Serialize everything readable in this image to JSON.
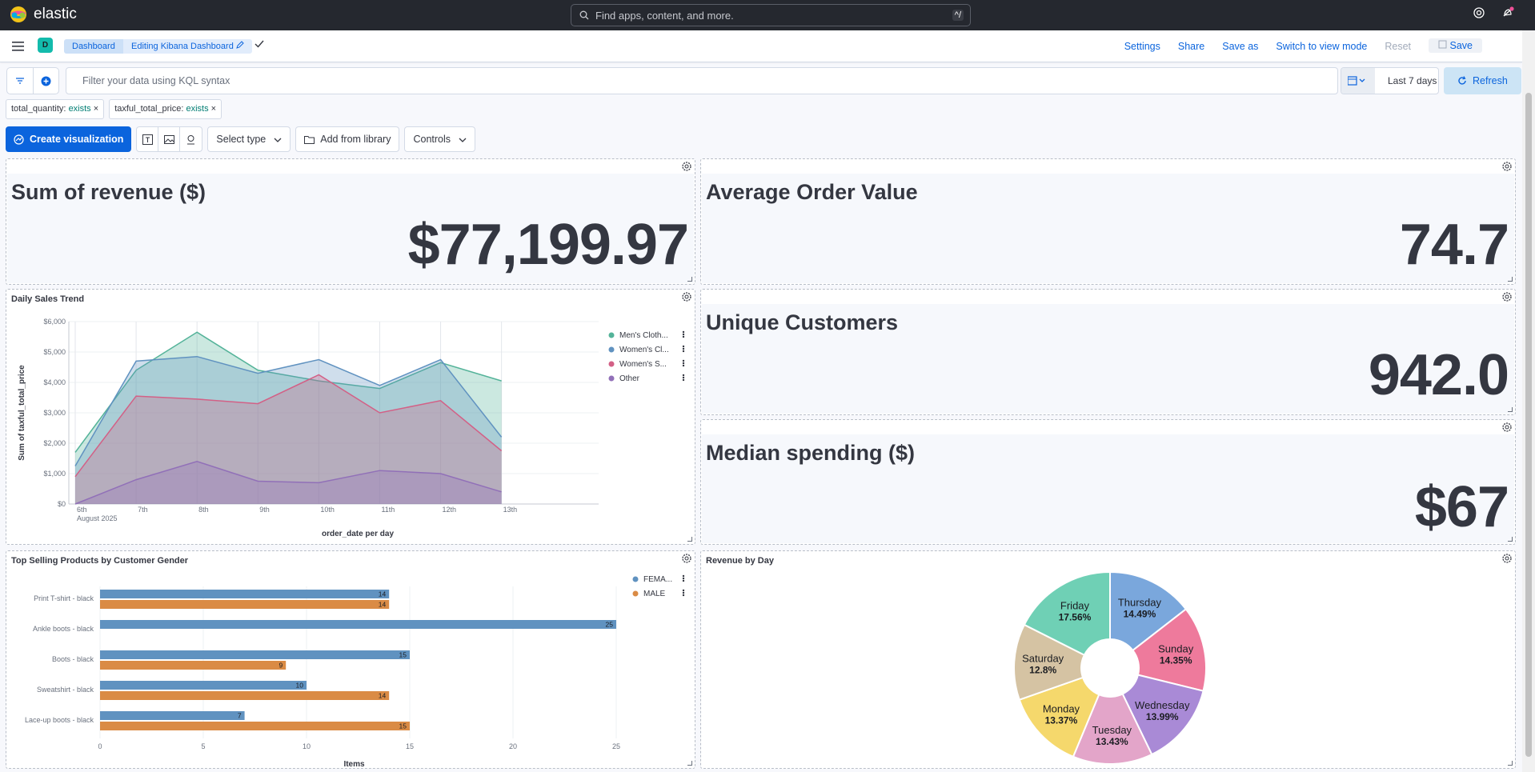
{
  "app": {
    "name": "elastic"
  },
  "search": {
    "placeholder": "Find apps, content, and more.",
    "shortcut": "^/"
  },
  "nav": {
    "avatar_letter": "D",
    "breadcrumbs": [
      "Dashboard",
      "Editing Kibana Dashboard"
    ],
    "menu": {
      "settings": "Settings",
      "share": "Share",
      "save_as": "Save as",
      "switch_view": "Switch to view mode",
      "reset": "Reset",
      "save": "Save"
    }
  },
  "query": {
    "placeholder": "Filter your data using KQL syntax",
    "time_range": "Last 7 days",
    "refresh": "Refresh"
  },
  "filters": [
    {
      "field": "total_quantity:",
      "op": "exists"
    },
    {
      "field": "taxful_total_price:",
      "op": "exists"
    }
  ],
  "toolbar": {
    "create": "Create visualization",
    "select_type": "Select type",
    "add_library": "Add from library",
    "controls": "Controls"
  },
  "metrics": {
    "revenue": {
      "title": "Sum of revenue ($)",
      "value": "$77,199.97"
    },
    "aov": {
      "title": "Average Order Value",
      "value": "74.7"
    },
    "customers": {
      "title": "Unique Customers",
      "value": "942.0"
    },
    "median": {
      "title": "Median spending ($)",
      "value": "$67"
    }
  },
  "panels": {
    "daily": "Daily Sales Trend",
    "products": "Top Selling Products by Customer Gender",
    "byday": "Revenue by Day"
  },
  "colors": {
    "accent": "#0b64dd",
    "green": "#54b399",
    "blue": "#6092c0",
    "pink": "#d36086",
    "purple": "#9170b8",
    "orange": "#da8b45"
  },
  "chart_data": [
    {
      "type": "area",
      "title": "Daily Sales Trend",
      "xlabel": "order_date per day",
      "ylabel": "Sum of taxful_total_price",
      "x": [
        "6th",
        "7th",
        "8th",
        "9th",
        "10th",
        "11th",
        "12th",
        "13th"
      ],
      "x_sublabel": "August 2025",
      "yticks": [
        "$0",
        "$1,000",
        "$2,000",
        "$3,000",
        "$4,000",
        "$5,000",
        "$6,000"
      ],
      "ylim": [
        0,
        6000
      ],
      "series": [
        {
          "name": "Men's Cloth...",
          "values": [
            1700,
            4400,
            5650,
            4400,
            4050,
            3800,
            4650,
            4050
          ]
        },
        {
          "name": "Women's Cl...",
          "values": [
            1250,
            4700,
            4850,
            4300,
            4750,
            3900,
            4750,
            2200
          ]
        },
        {
          "name": "Women's S...",
          "values": [
            900,
            3550,
            3450,
            3300,
            4250,
            3000,
            3400,
            1750
          ]
        },
        {
          "name": "Other",
          "values": [
            0,
            800,
            1400,
            750,
            700,
            1100,
            1000,
            400
          ]
        }
      ]
    },
    {
      "type": "bar",
      "title": "Top Selling Products by Customer Gender",
      "xlabel": "Items",
      "categories": [
        "Print T-shirt - black",
        "Ankle boots - black",
        "Boots - black",
        "Sweatshirt - black",
        "Lace-up boots - black"
      ],
      "xticks": [
        "0",
        "5",
        "10",
        "15",
        "20",
        "25"
      ],
      "xlim": [
        0,
        25
      ],
      "series": [
        {
          "name": "FEMA...",
          "values": [
            14,
            25,
            15,
            10,
            7
          ]
        },
        {
          "name": "MALE",
          "values": [
            14,
            null,
            9,
            14,
            15
          ]
        }
      ]
    },
    {
      "type": "pie",
      "title": "Revenue by Day",
      "slices": [
        {
          "label": "Thursday",
          "pct": "14.49%",
          "value": 14.49,
          "color": "#7aa7dc"
        },
        {
          "label": "Sunday",
          "pct": "14.35%",
          "value": 14.35,
          "color": "#ee7a9c"
        },
        {
          "label": "Wednesday",
          "pct": "13.99%",
          "value": 13.99,
          "color": "#a98ad6"
        },
        {
          "label": "Tuesday",
          "pct": "13.43%",
          "value": 13.43,
          "color": "#e3a5c9"
        },
        {
          "label": "Monday",
          "pct": "13.37%",
          "value": 13.37,
          "color": "#f5d86c"
        },
        {
          "label": "Saturday",
          "pct": "12.8%",
          "value": 12.8,
          "color": "#d5c3a3"
        },
        {
          "label": "Friday",
          "pct": "17.56%",
          "value": 17.56,
          "color": "#6fd0b5"
        }
      ]
    }
  ]
}
